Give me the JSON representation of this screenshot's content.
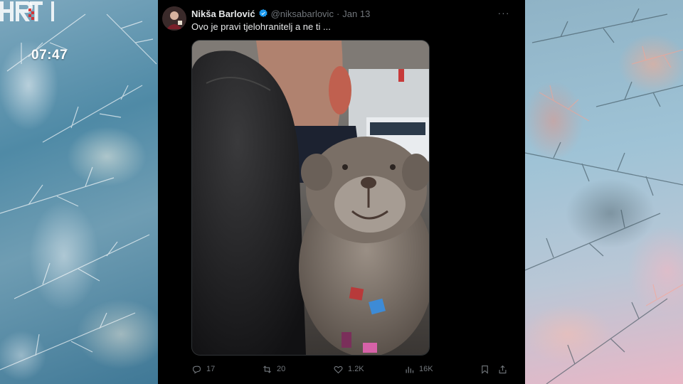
{
  "broadcast": {
    "logo_text": "HRT 1",
    "time": "07:47"
  },
  "tweet": {
    "author_name": "Nikša Barlović",
    "handle": "@niksabarlovic",
    "separator": "·",
    "date": "Jan 13",
    "more_label": "···",
    "text": "Ovo je pravi tjelohranitelj a ne ti ...",
    "media_description_icon": "photo-teddy-bear-in-car",
    "stats": {
      "replies": "17",
      "reposts": "20",
      "likes": "1.2K",
      "views": "16K"
    }
  },
  "colors": {
    "background": "#000000",
    "text_primary": "#e7e9ea",
    "text_secondary": "#71767b",
    "verified": "#1d9bf0"
  }
}
